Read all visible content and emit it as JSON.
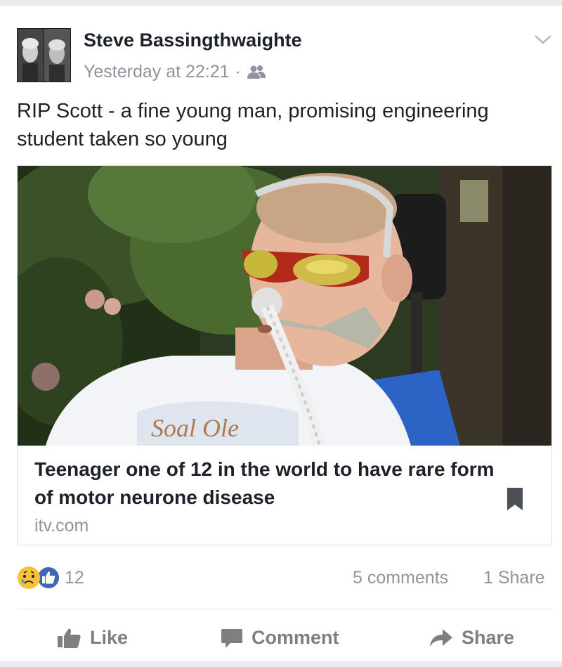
{
  "post": {
    "author": "Steve Bassingthwaighte",
    "timestamp": "Yesterday at 22:21",
    "separator": "·",
    "audience_icon": "friends-icon",
    "text": "RIP Scott - a fine young man, promising engineering student taken so young"
  },
  "link": {
    "title": "Teenager one of 12 in the world to have rare form of motor neurone disease",
    "domain": "itv.com",
    "save_icon": "bookmark-icon"
  },
  "stats": {
    "reactions_count": "12",
    "reaction_icons": [
      "sad-emoji-icon",
      "like-badge-icon"
    ],
    "comments": "5 comments",
    "shares": "1 Share"
  },
  "actions": {
    "like": "Like",
    "comment": "Comment",
    "share": "Share"
  },
  "colors": {
    "accent": "#4267b2",
    "muted": "#90949c",
    "action_gray": "#7f7f7f",
    "sad_yellow": "#f5c33b"
  }
}
